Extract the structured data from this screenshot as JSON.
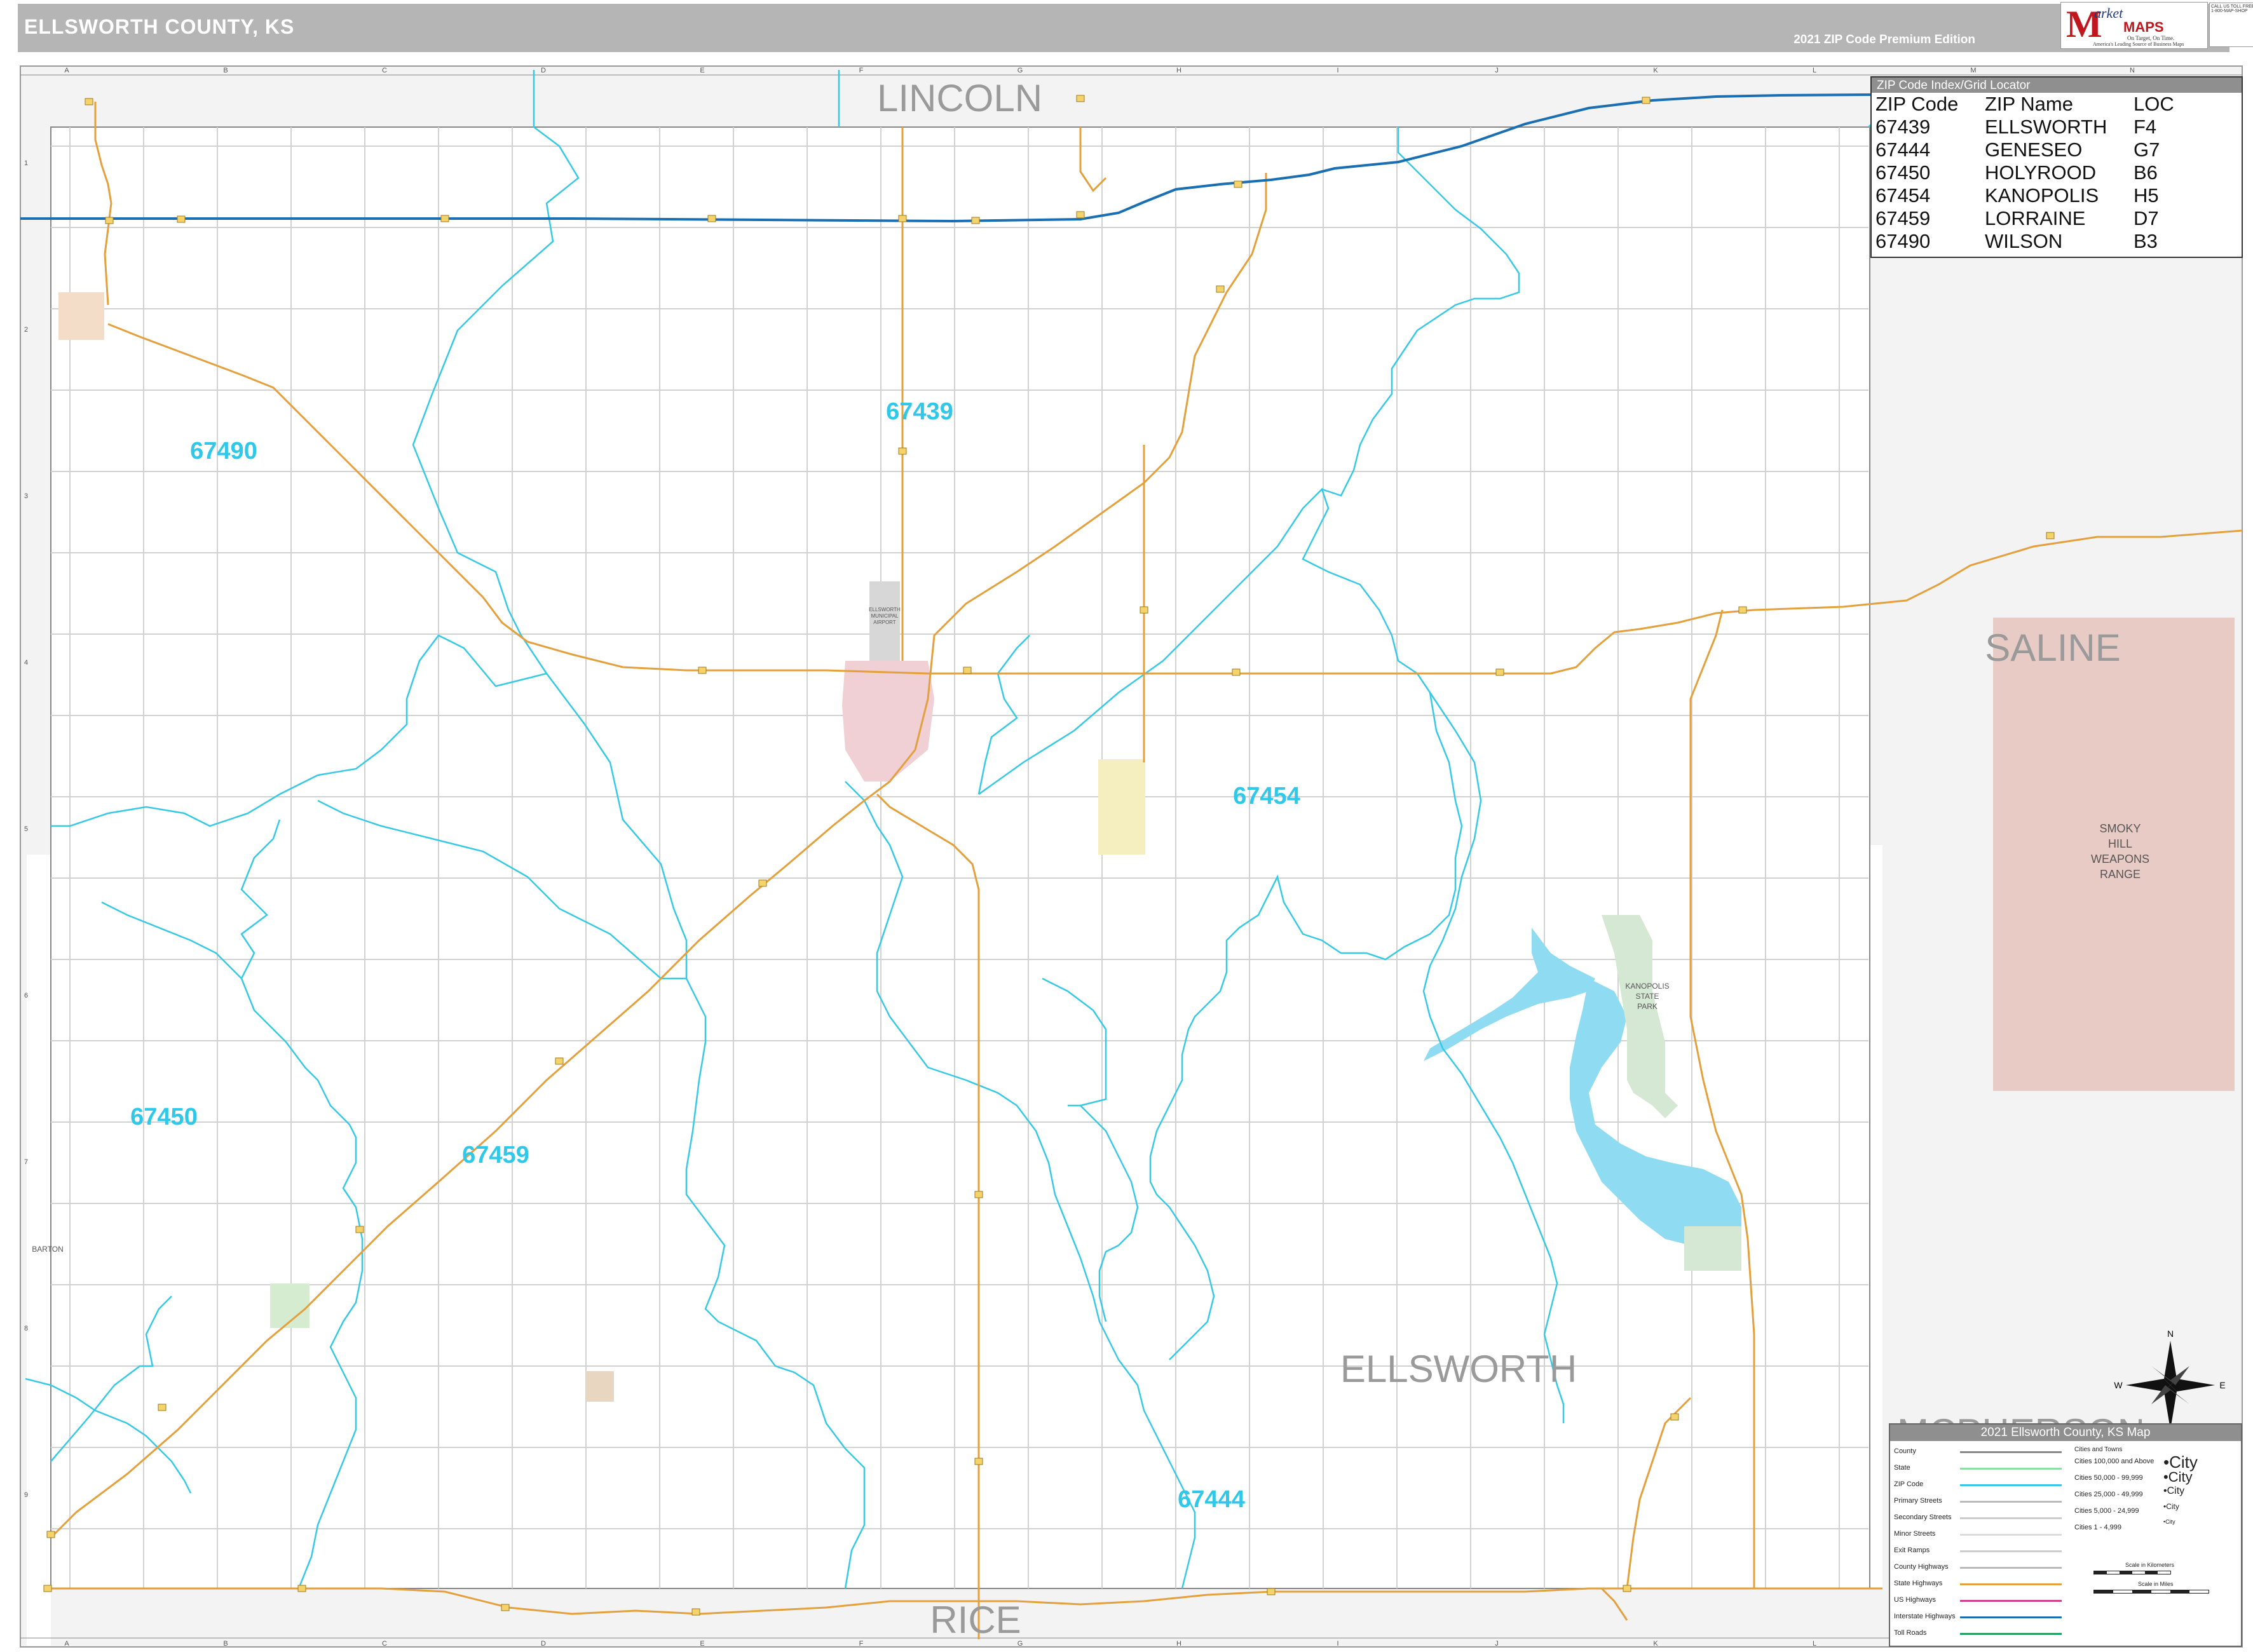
{
  "header": {
    "title": "ELLSWORTH COUNTY, KS",
    "edition": "2021 ZIP Code Premium Edition"
  },
  "logo": {
    "letter": "M",
    "market": "arket",
    "maps": "MAPS",
    "tagline1": "On Target, On Time.",
    "tagline2": "America's Leading Source of Business Maps",
    "phone": "CALL US TOLL FREE 1-800-MAP-SHOP"
  },
  "grid": {
    "columns": [
      "A",
      "B",
      "C",
      "D",
      "E",
      "F",
      "G",
      "H",
      "I",
      "J",
      "K",
      "L",
      "M",
      "N"
    ],
    "rows": [
      "1",
      "2",
      "3",
      "4",
      "5",
      "6",
      "7",
      "8",
      "9"
    ]
  },
  "regions": {
    "north": "LINCOLN",
    "east": "SALINE",
    "south": "RICE",
    "county": "ELLSWORTH",
    "southeast": "MCPHERSON",
    "west": "BARTON"
  },
  "zip_labels": [
    "67439",
    "67490",
    "67454",
    "67450",
    "67459",
    "67444"
  ],
  "features": {
    "weapons_range": [
      "SMOKY",
      "HILL",
      "WEAPONS",
      "RANGE"
    ],
    "state_park": [
      "KANOPOLIS",
      "STATE",
      "PARK"
    ],
    "airport": [
      "ELLSWORTH",
      "MUNICIPAL",
      "AIRPORT"
    ]
  },
  "zip_table": {
    "title": "ZIP Code Index/Grid Locator",
    "headers": [
      "ZIP Code",
      "ZIP Name",
      "LOC"
    ],
    "rows": [
      [
        "67439",
        "ELLSWORTH",
        "F4"
      ],
      [
        "67444",
        "GENESEO",
        "G7"
      ],
      [
        "67450",
        "HOLYROOD",
        "B6"
      ],
      [
        "67454",
        "KANOPOLIS",
        "H5"
      ],
      [
        "67459",
        "LORRAINE",
        "D7"
      ],
      [
        "67490",
        "WILSON",
        "B3"
      ]
    ]
  },
  "legend": {
    "title": "2021 Ellsworth County, KS Map",
    "items": [
      "County",
      "State",
      "ZIP Code",
      "Primary Streets",
      "Secondary Streets",
      "Minor Streets",
      "Exit Ramps",
      "County Highways",
      "State Highways",
      "US Highways",
      "Interstate Highways",
      "Toll Roads"
    ],
    "cities_header": "Cities and Towns",
    "cities": [
      [
        "Cities 100,000 and Above",
        "•City"
      ],
      [
        "Cities 50,000 - 99,999",
        "•City"
      ],
      [
        "Cities 25,000 - 49,999",
        "•City"
      ],
      [
        "Cities 5,000 - 24,999",
        "•City"
      ],
      [
        "Cities 1 - 4,999",
        "•City"
      ]
    ],
    "scale_km": "Scale in Kilometers",
    "scale_mi": "Scale in Miles"
  },
  "colors": {
    "zip_boundary": "#36c9e6",
    "interstate": "#1a6fb3",
    "state_highway": "#e3a03c",
    "water": "#8fdcf2",
    "weapons_range": "#e8cbc4",
    "park": "#d5e8d4",
    "city_ellsworth": "#f0cfd5",
    "city_kanopolis": "#f5efc0",
    "header": "#b5b5b5"
  }
}
